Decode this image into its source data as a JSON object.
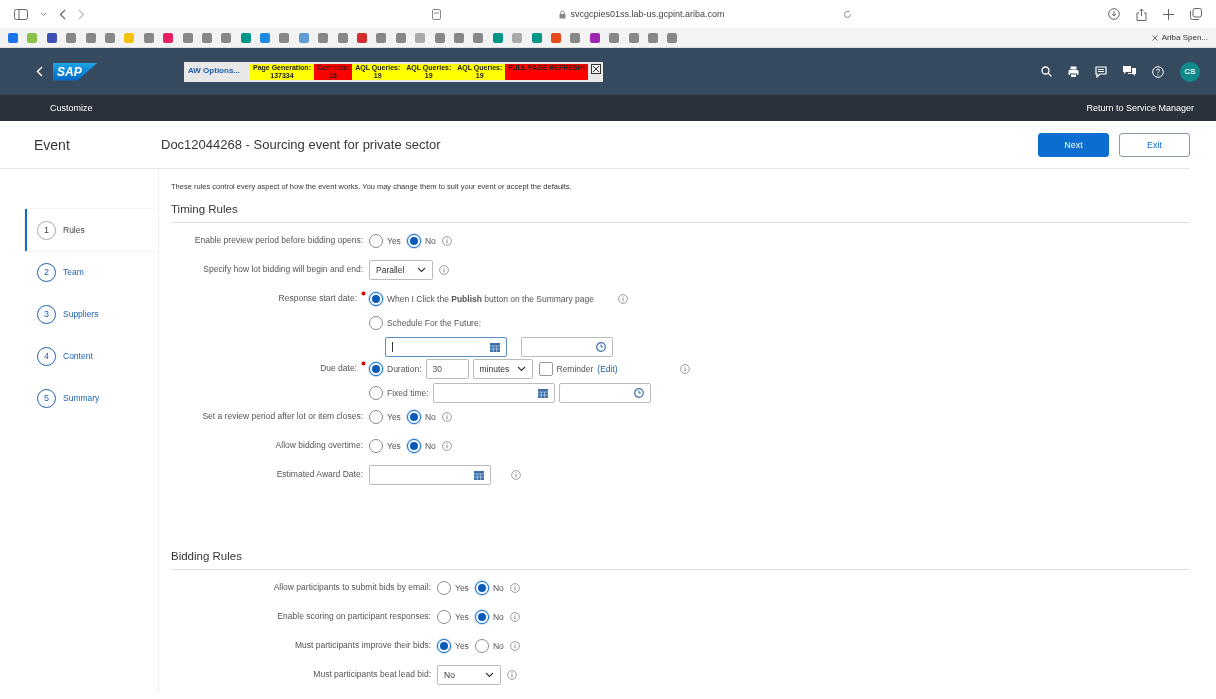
{
  "browser": {
    "url": "svcgcpies01ss.lab-us.gcpint.ariba.com",
    "tab_title": "Ariba Spen..."
  },
  "debug_bar": {
    "options": "AW Options...",
    "cells": [
      {
        "label": "Page Generation:",
        "value": "137334",
        "color": "#ffff00"
      },
      {
        "label": "Commits:",
        "value": "16",
        "color": "#ff0000"
      },
      {
        "label": "AQL Queries:",
        "value": "19",
        "color": "#ffff00"
      },
      {
        "label": "AQL Queries:",
        "value": "19",
        "color": "#ffff00"
      },
      {
        "label": "AQL Queries:",
        "value": "19",
        "color": "#ffff00"
      },
      {
        "label": "FULL PAGE REFRESH!",
        "color": "#ff0000"
      }
    ]
  },
  "header": {
    "logo": "SAP",
    "avatar": "CS"
  },
  "subnav": {
    "left": "Customize",
    "right": "Return to Service Manager"
  },
  "title_bar": {
    "section": "Event",
    "title": "Doc12044268 - Sourcing event for private sector",
    "buttons": [
      {
        "label": "Next",
        "kind": "primary"
      },
      {
        "label": "Exit",
        "kind": "secondary"
      }
    ]
  },
  "steps": [
    {
      "number": "1",
      "label": "Rules",
      "selected": true
    },
    {
      "number": "2",
      "label": "Team",
      "selected": false
    },
    {
      "number": "3",
      "label": "Suppliers",
      "selected": false
    },
    {
      "number": "4",
      "label": "Content",
      "selected": false
    },
    {
      "number": "5",
      "label": "Summary",
      "selected": false
    }
  ],
  "intro": "These rules control every aspect of how the event works. You may change them to suit your event or accept the defaults.",
  "sections": [
    {
      "title": "Timing Rules",
      "rows": [
        {
          "kind": "radio",
          "label": "Enable preview period before bidding opens:",
          "info": true,
          "options": [
            {
              "label": "Yes",
              "selected": false
            },
            {
              "label": "No",
              "selected": true
            }
          ]
        },
        {
          "kind": "select",
          "label": "Specify how lot bidding will begin and end:",
          "info": true,
          "value": "Parallel"
        },
        {
          "kind": "start",
          "label": "Response start date:",
          "required": true,
          "choices": [
            {
              "text": "When I Click the **Publish** button on the Summary page",
              "selected": true,
              "info": true
            },
            {
              "text": "Schedule For the Future:",
              "selected": false
            }
          ],
          "date_focused": true
        },
        {
          "kind": "due",
          "label": "Due date:",
          "required": true,
          "info": true,
          "choices": [
            {
              "text": "Duration:",
              "selected": true
            },
            {
              "text": "Fixed time:",
              "selected": false
            }
          ],
          "duration": "30",
          "unit": "minutes",
          "reminder": {
            "label": "Reminder",
            "link": "(Edit)",
            "checked": false
          }
        },
        {
          "kind": "radio",
          "label": "Set a review period after lot or item closes:",
          "info": true,
          "options": [
            {
              "label": "Yes",
              "selected": false
            },
            {
              "label": "No",
              "selected": true
            }
          ]
        },
        {
          "kind": "radio",
          "label": "Allow bidding overtime:",
          "info": true,
          "options": [
            {
              "label": "Yes",
              "selected": false
            },
            {
              "label": "No",
              "selected": true
            }
          ]
        },
        {
          "kind": "date",
          "label": "Estimated Award Date:",
          "info": true
        }
      ]
    },
    {
      "title": "Bidding Rules",
      "rows": [
        {
          "kind": "radio",
          "label": "Allow participants to submit bids by email:",
          "info": true,
          "options": [
            {
              "label": "Yes",
              "selected": false
            },
            {
              "label": "No",
              "selected": true
            }
          ]
        },
        {
          "kind": "radio",
          "label": "Enable scoring on participant responses:",
          "info": true,
          "options": [
            {
              "label": "Yes",
              "selected": false
            },
            {
              "label": "No",
              "selected": true
            }
          ]
        },
        {
          "kind": "radio",
          "label": "Must participants improve their bids:",
          "info": true,
          "options": [
            {
              "label": "Yes",
              "selected": true
            },
            {
              "label": "No",
              "selected": false
            }
          ]
        },
        {
          "kind": "select",
          "label": "Must participants beat lead bid:",
          "info": true,
          "value": "No"
        }
      ]
    }
  ]
}
